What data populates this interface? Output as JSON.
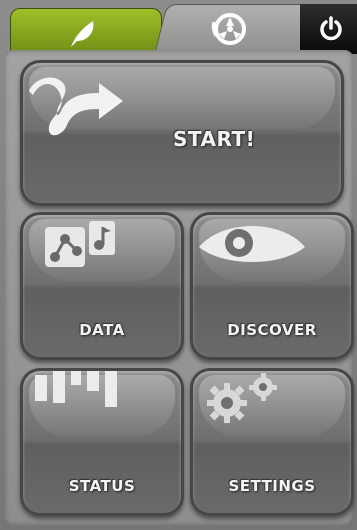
{
  "tabs": [
    {
      "name": "leaf",
      "icon": "leaf-icon",
      "color": "#8aab1f"
    },
    {
      "name": "logo",
      "icon": "reel-logo-icon"
    },
    {
      "name": "power",
      "icon": "power-icon"
    }
  ],
  "buttons": {
    "start": {
      "label": "START!",
      "icon": "route-arrow-icon"
    },
    "data": {
      "label": "DATA",
      "icon": "data-share-icon"
    },
    "discover": {
      "label": "DISCOVER",
      "icon": "eye-icon"
    },
    "status": {
      "label": "STATUS",
      "icon": "bars-icon"
    },
    "settings": {
      "label": "SETTINGS",
      "icon": "gears-icon"
    }
  },
  "colors": {
    "accent": "#8aab1f",
    "button_face": "#6f6f6d",
    "label": "#f4f4f2"
  }
}
